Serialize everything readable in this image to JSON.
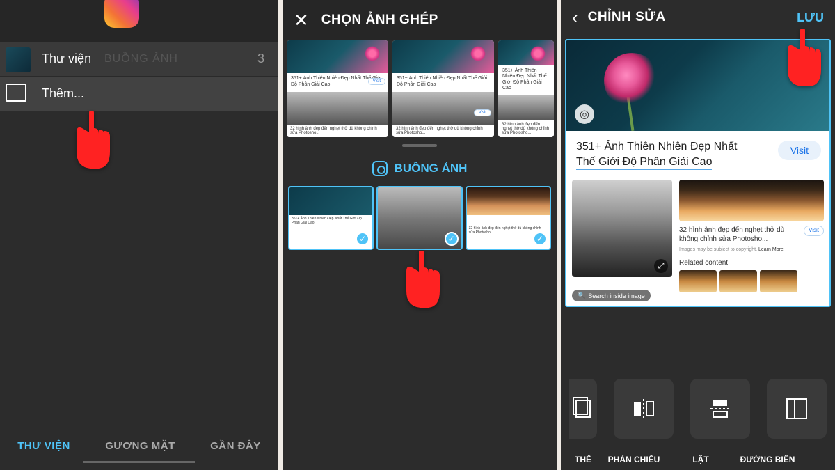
{
  "screen1": {
    "menu": {
      "gallery_label": "Thư viện",
      "more_label": "Thêm...",
      "ghost_label": "BUỒNG ẢNH",
      "count": "3"
    },
    "tabs": {
      "library": "THƯ VIỆN",
      "faces": "GƯƠNG MẶT",
      "recent": "GẦN ĐÂY"
    }
  },
  "screen2": {
    "header_title": "CHỌN ẢNH GHÉP",
    "section_title": "BUỒNG ẢNH",
    "card_title": "351+ Ảnh Thiên Nhiên Đẹp Nhất Thế Giới Độ Phân Giải Cao",
    "card_sub": "32 hình ảnh đẹp đến nghẹt thở dù không chỉnh sửa Photosho...",
    "visit_label": "Visit"
  },
  "screen3": {
    "header_title": "CHỈNH SỬA",
    "save_label": "LƯU",
    "article_title_1": "351+ Ảnh Thiên Nhiên Đẹp Nhất",
    "article_title_2": "Thế Giới Độ Phân Giải Cao",
    "visit_label": "Visit",
    "card2_text": "32 hình ảnh đẹp đến nghẹt thở dù không chỉnh sửa Photosho...",
    "meta_text": "Images may be subject to copyright.",
    "meta_link": "Learn More",
    "related_label": "Related content",
    "search_inside": "Search inside image",
    "tools": {
      "t0": "THẾ",
      "t1": "PHẢN CHIẾU",
      "t2": "LẬT",
      "t3": "ĐƯỜNG BIÊN"
    }
  }
}
